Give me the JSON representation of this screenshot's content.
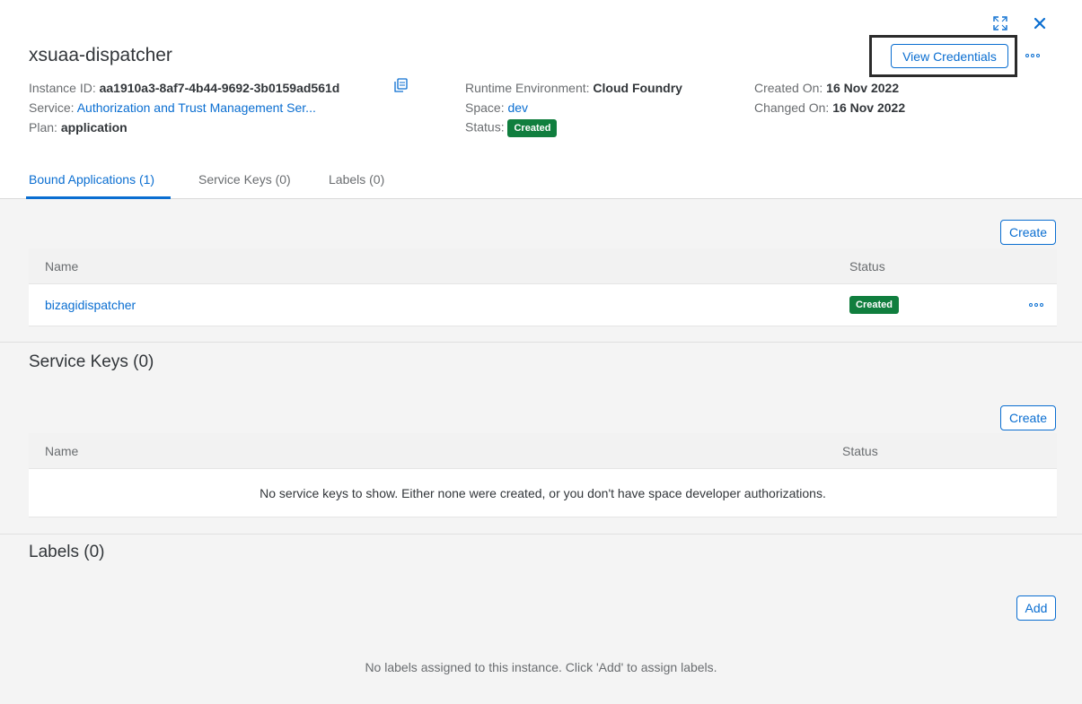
{
  "page": {
    "title": "xsuaa-dispatcher",
    "view_credentials": "View Credentials"
  },
  "meta": {
    "instance_id_label": "Instance ID:",
    "instance_id": "aa1910a3-8af7-4b44-9692-3b0159ad561d",
    "service_label": "Service:",
    "service": "Authorization and Trust Management Ser...",
    "plan_label": "Plan:",
    "plan": "application",
    "runtime_label": "Runtime Environment:",
    "runtime": "Cloud Foundry",
    "space_label": "Space:",
    "space": "dev",
    "status_label": "Status:",
    "status": "Created",
    "created_label": "Created On:",
    "created": "16 Nov 2022",
    "changed_label": "Changed On:",
    "changed": "16 Nov 2022"
  },
  "tabs": [
    {
      "label": "Bound Applications (1)",
      "active": true
    },
    {
      "label": "Service Keys (0)",
      "active": false
    },
    {
      "label": "Labels (0)",
      "active": false
    }
  ],
  "bound_apps": {
    "create_label": "Create",
    "columns": [
      "Name",
      "Status"
    ],
    "rows": [
      {
        "name": "bizagidispatcher",
        "status": "Created"
      }
    ]
  },
  "service_keys": {
    "title": "Service Keys (0)",
    "create_label": "Create",
    "columns": [
      "Name",
      "Status"
    ],
    "empty": "No service keys to show. Either none were created, or you don't have space developer authorizations."
  },
  "labels": {
    "title": "Labels (0)",
    "add_label": "Add",
    "empty": "No labels assigned to this instance. Click 'Add' to assign labels."
  },
  "colors": {
    "accent": "#0a6ed1",
    "success": "#107e3e",
    "text": "#32363a",
    "muted": "#6a6d70"
  },
  "icons": [
    "fullscreen-icon",
    "close-icon",
    "copy-icon",
    "more-icon"
  ]
}
